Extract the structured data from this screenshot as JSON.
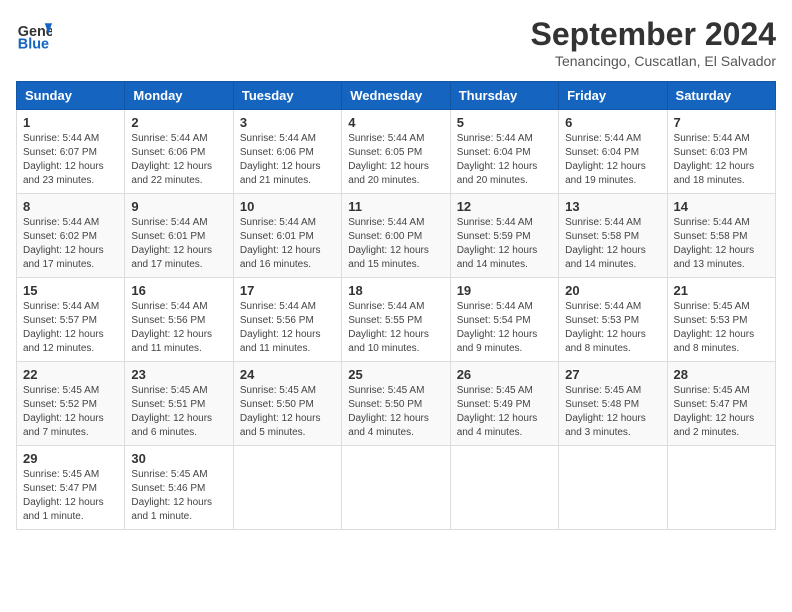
{
  "header": {
    "logo_line1": "General",
    "logo_line2": "Blue",
    "month": "September 2024",
    "location": "Tenancingo, Cuscatlan, El Salvador"
  },
  "columns": [
    "Sunday",
    "Monday",
    "Tuesday",
    "Wednesday",
    "Thursday",
    "Friday",
    "Saturday"
  ],
  "weeks": [
    [
      {
        "day": "1",
        "info": "Sunrise: 5:44 AM\nSunset: 6:07 PM\nDaylight: 12 hours\nand 23 minutes."
      },
      {
        "day": "2",
        "info": "Sunrise: 5:44 AM\nSunset: 6:06 PM\nDaylight: 12 hours\nand 22 minutes."
      },
      {
        "day": "3",
        "info": "Sunrise: 5:44 AM\nSunset: 6:06 PM\nDaylight: 12 hours\nand 21 minutes."
      },
      {
        "day": "4",
        "info": "Sunrise: 5:44 AM\nSunset: 6:05 PM\nDaylight: 12 hours\nand 20 minutes."
      },
      {
        "day": "5",
        "info": "Sunrise: 5:44 AM\nSunset: 6:04 PM\nDaylight: 12 hours\nand 20 minutes."
      },
      {
        "day": "6",
        "info": "Sunrise: 5:44 AM\nSunset: 6:04 PM\nDaylight: 12 hours\nand 19 minutes."
      },
      {
        "day": "7",
        "info": "Sunrise: 5:44 AM\nSunset: 6:03 PM\nDaylight: 12 hours\nand 18 minutes."
      }
    ],
    [
      {
        "day": "8",
        "info": "Sunrise: 5:44 AM\nSunset: 6:02 PM\nDaylight: 12 hours\nand 17 minutes."
      },
      {
        "day": "9",
        "info": "Sunrise: 5:44 AM\nSunset: 6:01 PM\nDaylight: 12 hours\nand 17 minutes."
      },
      {
        "day": "10",
        "info": "Sunrise: 5:44 AM\nSunset: 6:01 PM\nDaylight: 12 hours\nand 16 minutes."
      },
      {
        "day": "11",
        "info": "Sunrise: 5:44 AM\nSunset: 6:00 PM\nDaylight: 12 hours\nand 15 minutes."
      },
      {
        "day": "12",
        "info": "Sunrise: 5:44 AM\nSunset: 5:59 PM\nDaylight: 12 hours\nand 14 minutes."
      },
      {
        "day": "13",
        "info": "Sunrise: 5:44 AM\nSunset: 5:58 PM\nDaylight: 12 hours\nand 14 minutes."
      },
      {
        "day": "14",
        "info": "Sunrise: 5:44 AM\nSunset: 5:58 PM\nDaylight: 12 hours\nand 13 minutes."
      }
    ],
    [
      {
        "day": "15",
        "info": "Sunrise: 5:44 AM\nSunset: 5:57 PM\nDaylight: 12 hours\nand 12 minutes."
      },
      {
        "day": "16",
        "info": "Sunrise: 5:44 AM\nSunset: 5:56 PM\nDaylight: 12 hours\nand 11 minutes."
      },
      {
        "day": "17",
        "info": "Sunrise: 5:44 AM\nSunset: 5:56 PM\nDaylight: 12 hours\nand 11 minutes."
      },
      {
        "day": "18",
        "info": "Sunrise: 5:44 AM\nSunset: 5:55 PM\nDaylight: 12 hours\nand 10 minutes."
      },
      {
        "day": "19",
        "info": "Sunrise: 5:44 AM\nSunset: 5:54 PM\nDaylight: 12 hours\nand 9 minutes."
      },
      {
        "day": "20",
        "info": "Sunrise: 5:44 AM\nSunset: 5:53 PM\nDaylight: 12 hours\nand 8 minutes."
      },
      {
        "day": "21",
        "info": "Sunrise: 5:45 AM\nSunset: 5:53 PM\nDaylight: 12 hours\nand 8 minutes."
      }
    ],
    [
      {
        "day": "22",
        "info": "Sunrise: 5:45 AM\nSunset: 5:52 PM\nDaylight: 12 hours\nand 7 minutes."
      },
      {
        "day": "23",
        "info": "Sunrise: 5:45 AM\nSunset: 5:51 PM\nDaylight: 12 hours\nand 6 minutes."
      },
      {
        "day": "24",
        "info": "Sunrise: 5:45 AM\nSunset: 5:50 PM\nDaylight: 12 hours\nand 5 minutes."
      },
      {
        "day": "25",
        "info": "Sunrise: 5:45 AM\nSunset: 5:50 PM\nDaylight: 12 hours\nand 4 minutes."
      },
      {
        "day": "26",
        "info": "Sunrise: 5:45 AM\nSunset: 5:49 PM\nDaylight: 12 hours\nand 4 minutes."
      },
      {
        "day": "27",
        "info": "Sunrise: 5:45 AM\nSunset: 5:48 PM\nDaylight: 12 hours\nand 3 minutes."
      },
      {
        "day": "28",
        "info": "Sunrise: 5:45 AM\nSunset: 5:47 PM\nDaylight: 12 hours\nand 2 minutes."
      }
    ],
    [
      {
        "day": "29",
        "info": "Sunrise: 5:45 AM\nSunset: 5:47 PM\nDaylight: 12 hours\nand 1 minute."
      },
      {
        "day": "30",
        "info": "Sunrise: 5:45 AM\nSunset: 5:46 PM\nDaylight: 12 hours\nand 1 minute."
      },
      {
        "day": "",
        "info": ""
      },
      {
        "day": "",
        "info": ""
      },
      {
        "day": "",
        "info": ""
      },
      {
        "day": "",
        "info": ""
      },
      {
        "day": "",
        "info": ""
      }
    ]
  ]
}
